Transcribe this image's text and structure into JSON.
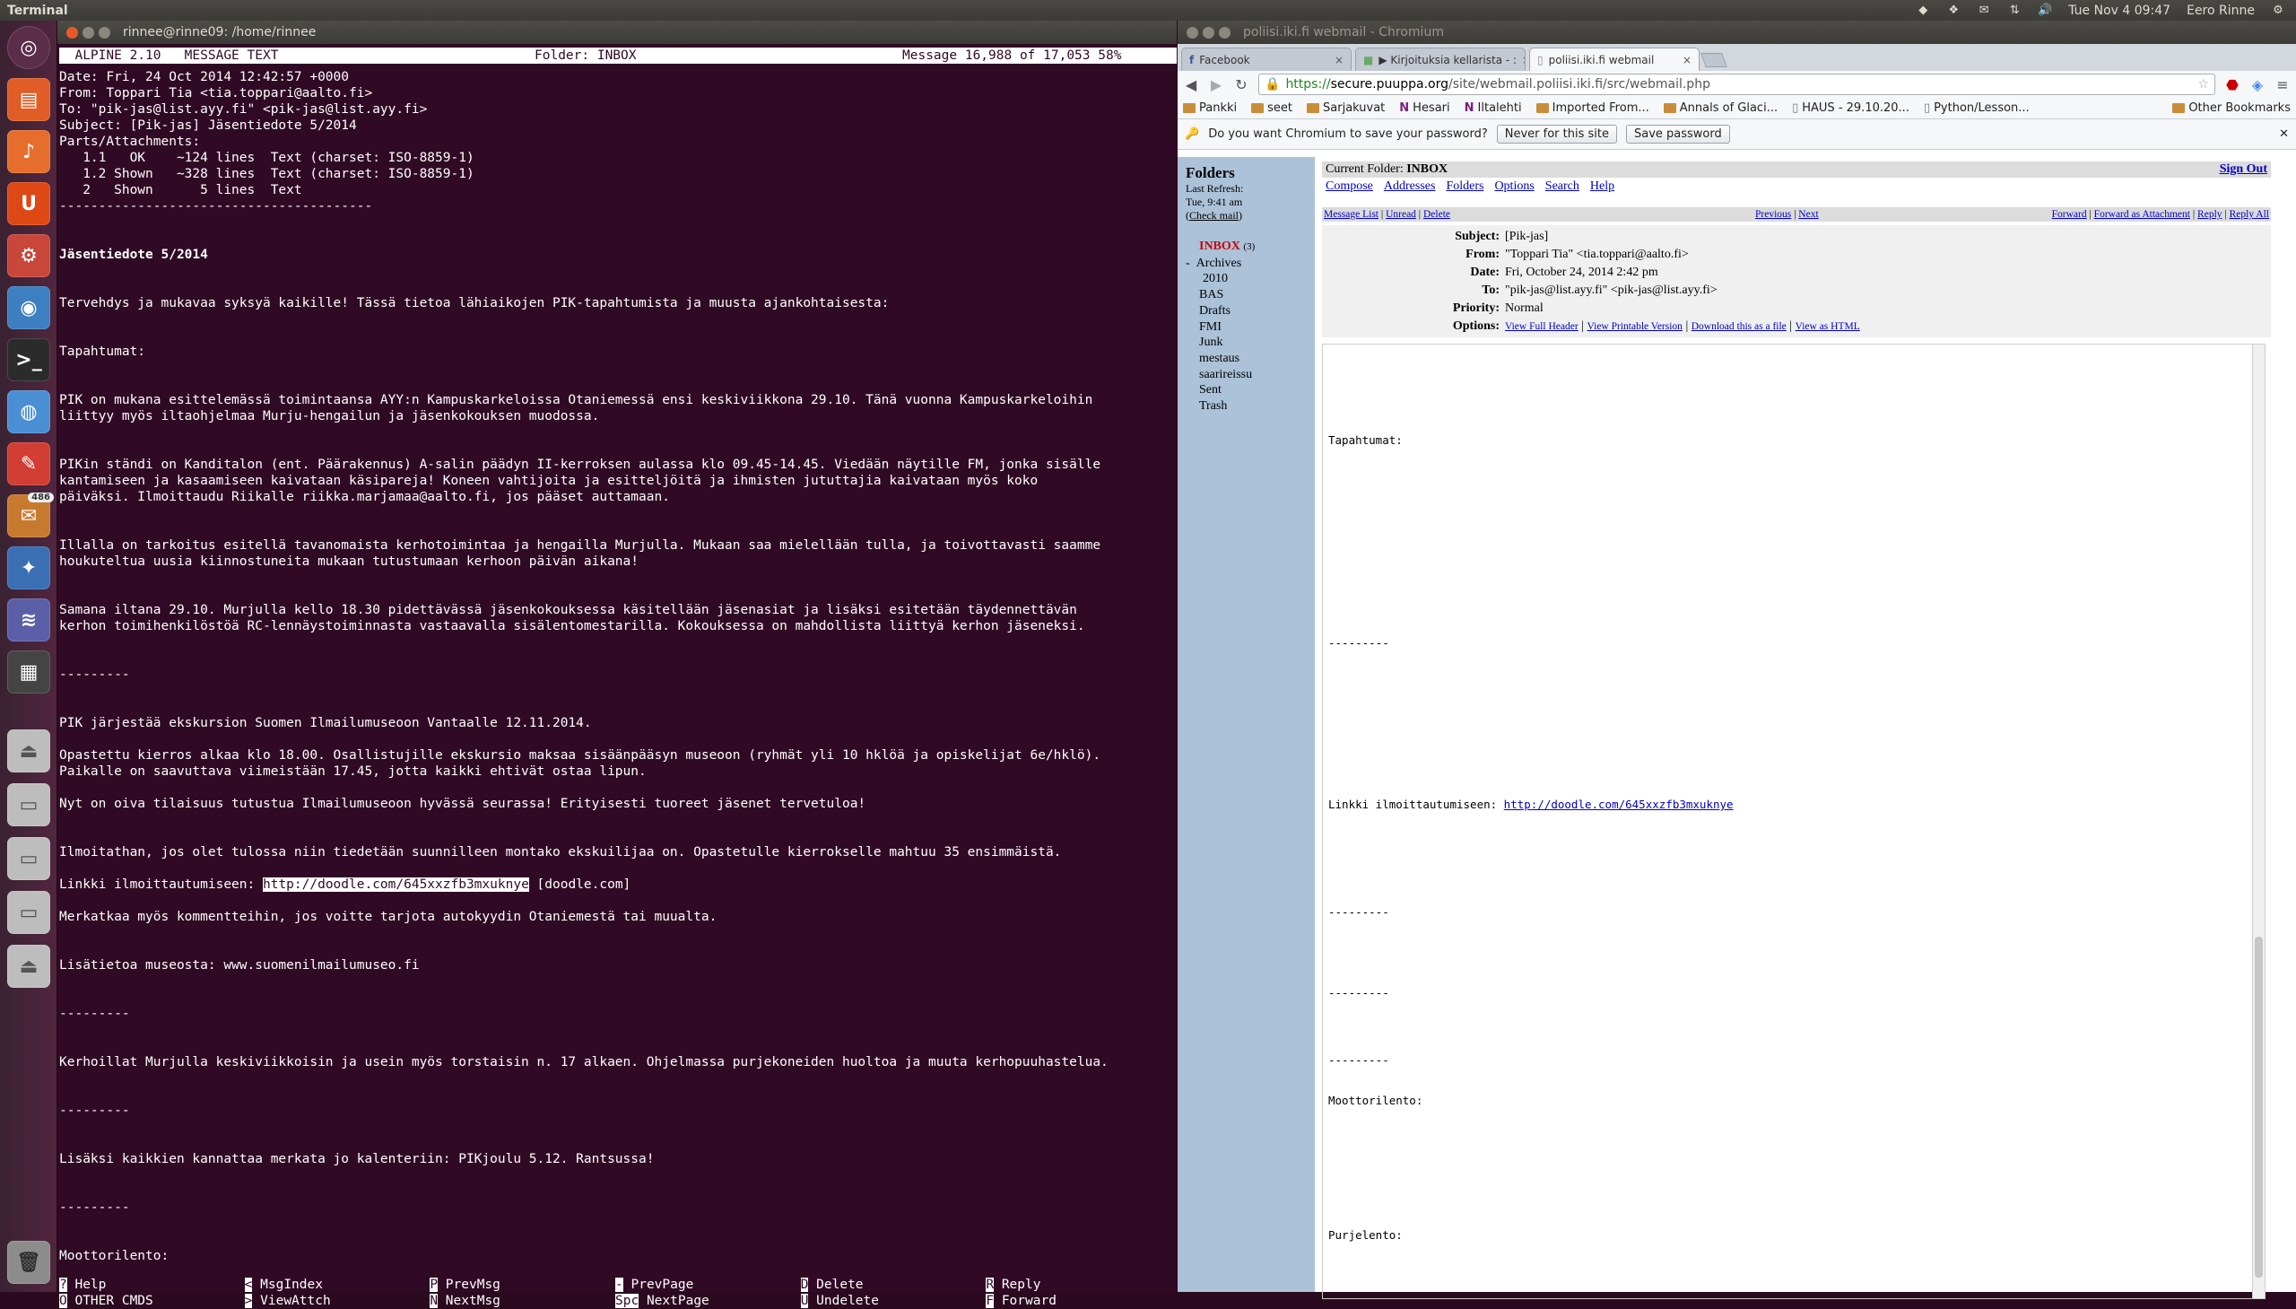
{
  "toppanel": {
    "app_name": "Terminal",
    "datetime": "Tue Nov 4 09:47",
    "user": "Eero Rinne"
  },
  "launcher": {
    "badge": "486",
    "items": [
      "dash-icon",
      "files-icon",
      "rhythmbox-icon",
      "ubuntu-one-icon",
      "settings-icon",
      "firefox-icon",
      "terminal-icon",
      "chromium-icon",
      "evince-icon",
      "mail-icon",
      "thunderbird-icon",
      "app-icon",
      "workspace-icon",
      "drive-icon",
      "drive-icon",
      "drive-icon",
      "drive-icon",
      "drive-icon",
      "trash-icon"
    ]
  },
  "terminal": {
    "title": "rinnee@rinne09: /home/rinnee",
    "status_left": "  ALPINE 2.10   MESSAGE TEXT",
    "status_mid": "Folder: INBOX",
    "status_right": "Message 16,988 of 17,053 58%",
    "header_lines": [
      "Date: Fri, 24 Oct 2014 12:42:57 +0000",
      "From: Toppari Tia <tia.toppari@aalto.fi>",
      "To: \"pik-jas@list.ayy.fi\" <pik-jas@list.ayy.fi>",
      "Subject: [Pik-jas] Jäsentiedote 5/2014",
      "Parts/Attachments:",
      "   1.1   OK    ~124 lines  Text (charset: ISO-8859-1)",
      "   1.2 Shown   ~328 lines  Text (charset: ISO-8859-1)",
      "   2   Shown      5 lines  Text",
      "----------------------------------------"
    ],
    "body_title": "Jäsentiedote 5/2014",
    "body_lines": [
      "Tervehdys ja mukavaa syksyä kaikille! Tässä tietoa lähiaikojen PIK-tapahtumista ja muusta ajankohtaisesta:",
      "Tapahtumat:",
      "PIK on mukana esittelemässä toimintaansa AYY:n Kampuskarkeloissa Otaniemessä ensi keskiviikkona 29.10. Tänä vuonna Kampuskarkeloihin",
      "liittyy myös iltaohjelmaa Murju-hengailun ja jäsenkokouksen muodossa.",
      "PIKin ständi on Kanditalon (ent. Päärakennus) A-salin päädyn II-kerroksen aulassa klo 09.45-14.45. Viedään näytille FM, jonka sisälle",
      "kantamiseen ja kasaamiseen kaivataan käsipareja! Koneen vahtijoita ja esitteljöitä ja ihmisten jututtajia kaivataan myös koko",
      "päiväksi. Ilmoittaudu Riikalle riikka.marjamaa@aalto.fi, jos pääset auttamaan.",
      "Illalla on tarkoitus esitellä tavanomaista kerhotoimintaa ja hengailla Murjulla. Mukaan saa mielellään tulla, ja toivottavasti saamme",
      "houkuteltua uusia kiinnostuneita mukaan tutustumaan kerhoon päivän aikana!",
      "Samana iltana 29.10. Murjulla kello 18.30 pidettävässä jäsenkokouksessa käsitellään jäsenasiat ja lisäksi esitetään täydennettävän",
      "kerhon toimihenkilöstöä RC-lennäystoiminnasta vastaavalla sisälentomestarilla. Kokouksessa on mahdollista liittyä kerhon jäseneksi.",
      "---------",
      "PIK järjestää ekskursion Suomen Ilmailumuseoon Vantaalle 12.11.2014.",
      "Opastettu kierros alkaa klo 18.00. Osallistujille ekskursio maksaa sisäänpääsyn museoon (ryhmät yli 10 hklöä ja opiskelijat 6e/hklö).",
      "Paikalle on saavuttava viimeistään 17.45, jotta kaikki ehtivät ostaa lipun.",
      "Nyt on oiva tilaisuus tutustua Ilmailumuseoon hyvässä seurassa! Erityisesti tuoreet jäsenet tervetuloa!",
      "Ilmoitathan, jos olet tulossa niin tiedetään suunnilleen montako ekskuilijaa on. Opastetulle kierrokselle mahtuu 35 ensimmäistä.",
      "Linkki ilmoittautumiseen: ",
      "http://doodle.com/645xxzfb3mxuknye",
      " [doodle.com]",
      "Merkatkaa myös kommentteihin, jos voitte tarjota autokyydin Otaniemestä tai muualta.",
      "Lisätietoa museosta: www.suomenilmailumuseo.fi",
      "---------",
      "Kerhoillat Murjulla keskiviikkoisin ja usein myös torstaisin n. 17 alkaen. Ohjelmassa purjekoneiden huoltoa ja muuta kerhopuuhastelua.",
      "---------",
      "Lisäksi kaikkien kannattaa merkata jo kalenteriin: PIKjoulu 5.12. Rantsussa!",
      "---------",
      "Moottorilento:"
    ],
    "keys": [
      [
        {
          "k": "?",
          "l": " Help"
        },
        {
          "k": "<",
          "l": " MsgIndex"
        },
        {
          "k": "P",
          "l": " PrevMsg"
        },
        {
          "k": "-",
          "l": " PrevPage"
        },
        {
          "k": "D",
          "l": " Delete"
        },
        {
          "k": "R",
          "l": " Reply"
        }
      ],
      [
        {
          "k": "O",
          "l": " OTHER CMDS"
        },
        {
          "k": ">",
          "l": " ViewAttch"
        },
        {
          "k": "N",
          "l": " NextMsg"
        },
        {
          "k": "Spc",
          "l": " NextPage"
        },
        {
          "k": "U",
          "l": " Undelete"
        },
        {
          "k": "F",
          "l": " Forward"
        }
      ]
    ]
  },
  "chrome": {
    "title": "poliisi.iki.fi webmail - Chromium",
    "tabs": [
      "Facebook",
      "▶ Kirjoituksia kellarista - :",
      "poliisi.iki.fi webmail"
    ],
    "url_https": "https://",
    "url_host": "secure.puuppa.org",
    "url_path": "/site/webmail.poliisi.iki.fi/src/webmail.php",
    "bookmarks": [
      "Pankki",
      "seet",
      "Sarjakuvat",
      "Hesari",
      "Iltalehti",
      "Imported From...",
      "Annals of Glaci...",
      "HAUS - 29.10.20...",
      "Python/Lesson...",
      "Other Bookmarks"
    ],
    "infobar_text": "Do you want Chromium to save your password?",
    "infobar_never": "Never for this site",
    "infobar_save": "Save password"
  },
  "webmail": {
    "folders_title": "Folders",
    "last_refresh_label": "Last Refresh:",
    "last_refresh_time": "Tue, 9:41 am",
    "check_mail": "Check mail",
    "inbox": "INBOX",
    "inbox_count": "(3)",
    "folders": [
      "Archives",
      "2010",
      "BAS",
      "Drafts",
      "FMI",
      "Junk",
      "mestaus",
      "saarireissu",
      "Sent",
      "Trash"
    ],
    "current_folder_label": "Current Folder:",
    "current_folder": "INBOX",
    "sign_out": "Sign Out",
    "menu": [
      "Compose",
      "Addresses",
      "Folders",
      "Options",
      "Search",
      "Help"
    ],
    "msgnav_left": [
      "Message List",
      "Unread",
      "Delete"
    ],
    "msgnav_mid": [
      "Previous",
      "Next"
    ],
    "msgnav_right": [
      "Forward",
      "Forward as Attachment",
      "Reply",
      "Reply All"
    ],
    "headers": {
      "subject_label": "Subject:",
      "subject": "[Pik-jas]",
      "from_label": "From:",
      "from": "\"Toppari Tia\" <tia.toppari@aalto.fi>",
      "date_label": "Date:",
      "date": "Fri, October 24, 2014 2:42 pm",
      "to_label": "To:",
      "to": "\"pik-jas@list.ayy.fi\" <pik-jas@list.ayy.fi>",
      "priority_label": "Priority:",
      "priority": "Normal",
      "options_label": "Options:",
      "options": [
        "View Full Header",
        "View Printable Version",
        "Download this as a file",
        "View as HTML"
      ]
    },
    "body": {
      "tapahtumat": "Tapahtumat:",
      "sep": "---------",
      "link_label": "Linkki ilmoittautumiseen: ",
      "link": "http://doodle.com/645xxzfb3mxuknye",
      "moottorilento": "Moottorilento:",
      "purjelento": "Purjelento:"
    }
  }
}
